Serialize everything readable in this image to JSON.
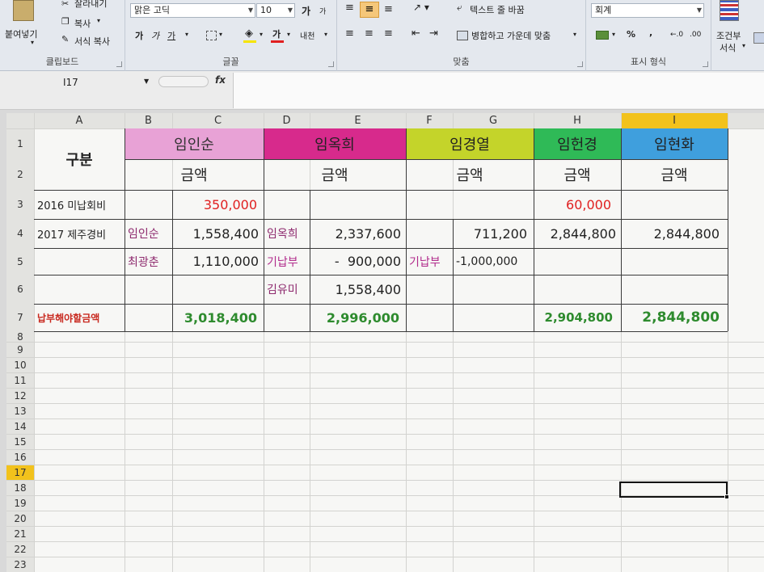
{
  "ribbon": {
    "clipboard": {
      "paste_label": "붙여넣기",
      "cut_label": "잘라내기",
      "copy_label": "복사",
      "format_painter_label": "서식 복사",
      "group_label": "클립보드"
    },
    "font": {
      "font_name": "맑은 고딕",
      "font_size": "10",
      "grow_label": "가",
      "shrink_label": "가",
      "bold_label": "가",
      "italic_label": "가",
      "underline_label": "가",
      "font_color_label": "가",
      "phonetic_label": "내천",
      "group_label": "글꼴"
    },
    "alignment": {
      "wrap_text_label": "텍스트 줄 바꿈",
      "merge_center_label": "병합하고 가운데 맞춤",
      "group_label": "맞춤"
    },
    "number": {
      "format_value": "회계",
      "percent_label": "%",
      "comma_label": ",",
      "group_label": "표시 형식"
    },
    "styles": {
      "conditional_label_1": "조건부",
      "conditional_label_2": "서식"
    }
  },
  "formula_bar": {
    "name_box": "I17",
    "fx_label": "fx",
    "formula": ""
  },
  "sheet": {
    "columns": [
      "A",
      "B",
      "C",
      "D",
      "E",
      "F",
      "G",
      "H",
      "I"
    ],
    "rows": [
      "1",
      "2",
      "3",
      "4",
      "5",
      "6",
      "7",
      "8",
      "9",
      "10",
      "11",
      "12",
      "13",
      "14",
      "15",
      "16",
      "17",
      "18",
      "19",
      "20",
      "21",
      "22",
      "23"
    ],
    "active_cell": "I17",
    "header_row1": {
      "category": "구분",
      "p1": "임인순",
      "p2": "임옥희",
      "p3": "임경열",
      "p4": "임헌경",
      "p5": "임현화"
    },
    "header_row2": {
      "a1": "금액",
      "a2": "금액",
      "a3": "금액",
      "a4": "금액",
      "a5": "금액"
    },
    "row3": {
      "label": "2016 미납회비",
      "c": "350,000",
      "h": "60,000"
    },
    "row4": {
      "label": "2017 제주경비",
      "b": "임인순",
      "c": "1,558,400",
      "d": "임옥희",
      "e": "2,337,600",
      "g": "711,200",
      "h": "2,844,800",
      "i": "2,844,800"
    },
    "row5": {
      "b": "최광춘",
      "c": "1,110,000",
      "d": "기납부",
      "e": "-  900,000",
      "f": "기납부",
      "g": "-1,000,000"
    },
    "row6": {
      "d": "김유미",
      "e": "1,558,400"
    },
    "row7": {
      "label": "납부해야할금액",
      "c": "3,018,400",
      "e": "2,996,000",
      "h": "2,904,800",
      "i": "2,844,800"
    }
  },
  "colors": {
    "p1_fill": "#e8a2d6",
    "p2_fill": "#d72a8c",
    "p3_fill": "#c4d42a",
    "p4_fill": "#2fba57",
    "p5_fill": "#3f9fdd",
    "col_i_header": "#f2c21c",
    "red_text": "#e02020",
    "purple_text": "#8e2a6e",
    "magenta_text": "#b12b8c",
    "green_text": "#2e8b2e",
    "dark_red_text": "#c8281e"
  }
}
